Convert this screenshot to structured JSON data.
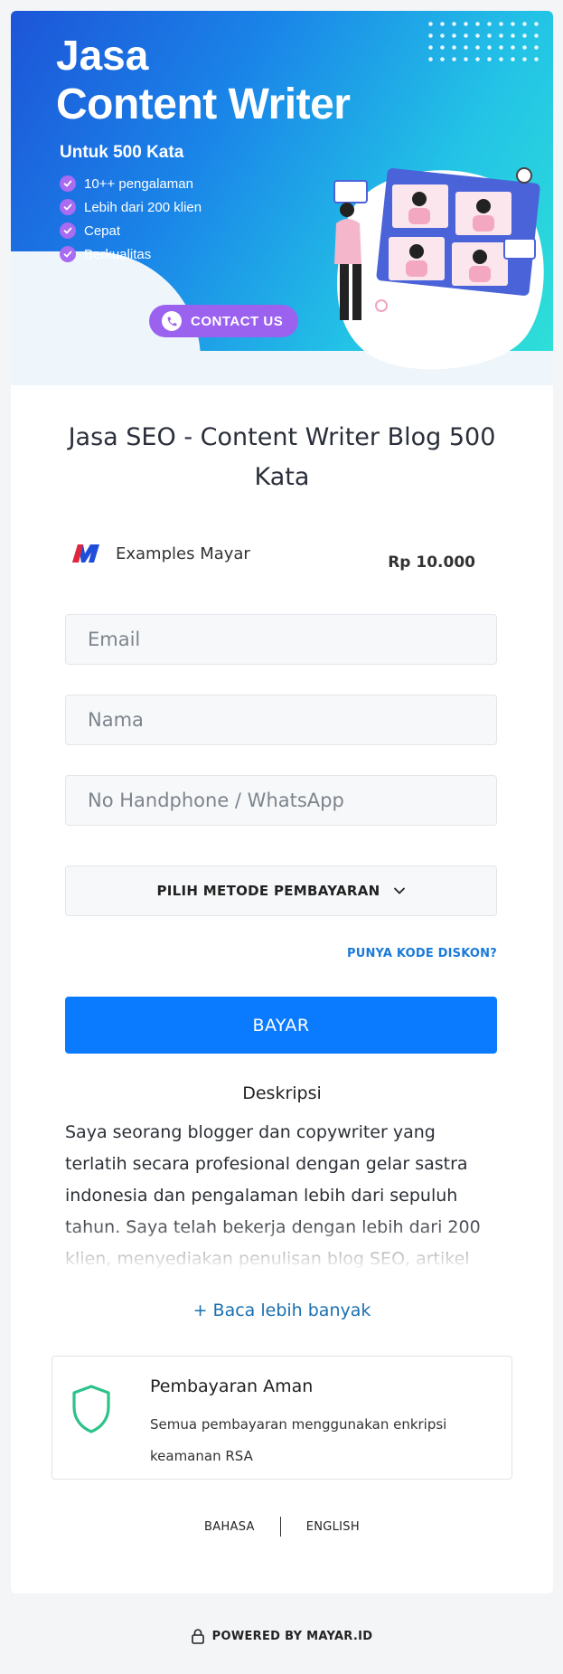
{
  "banner": {
    "title_line1": "Jasa",
    "title_line2": "Content Writer",
    "subtitle": "Untuk 500 Kata",
    "features": [
      "10++ pengalaman",
      "Lebih dari 200 klien",
      "Cepat",
      "Berkualitas"
    ],
    "contact_label": "CONTACT US",
    "accent_color": "#9b62f0"
  },
  "product": {
    "title": "Jasa SEO - Content Writer Blog 500 Kata",
    "merchant_name": "Examples Mayar",
    "price": "Rp 10.000"
  },
  "form": {
    "email_placeholder": "Email",
    "name_placeholder": "Nama",
    "phone_placeholder": "No Handphone / WhatsApp",
    "payment_method_label": "PILIH METODE PEMBAYARAN",
    "discount_link": "PUNYA KODE DISKON?",
    "submit_label": "BAYAR",
    "submit_color": "#0a7aff"
  },
  "description": {
    "heading": "Deskripsi",
    "text": "Saya seorang blogger dan copywriter yang terlatih secara profesional dengan gelar sastra indonesia dan pengalaman lebih dari sepuluh tahun. Saya telah bekerja dengan lebih dari 200 klien, menyediakan penulisan blog SEO, artikel",
    "read_more": "+ Baca lebih banyak"
  },
  "secure_payment": {
    "heading": "Pembayaran Aman",
    "text": "Semua pembayaran menggunakan enkripsi keamanan RSA",
    "icon": "shield-icon",
    "icon_color": "#2cc28a"
  },
  "language": {
    "option1": "BAHASA",
    "option2": "ENGLISH"
  },
  "footer": {
    "powered_by": "POWERED BY MAYAR.ID"
  }
}
